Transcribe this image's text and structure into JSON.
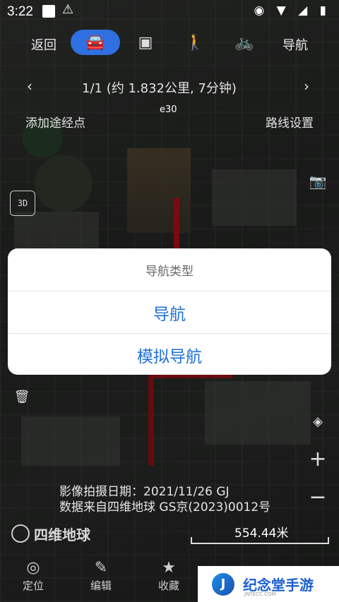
{
  "status_bar": {
    "time": "3:22",
    "warning_icon": "warning-icon",
    "right_icons": "◉ ▼ ◢ ▮"
  },
  "top_nav": {
    "back_label": "返回",
    "modes": [
      "car-icon",
      "bus-icon",
      "walk-icon",
      "bike-icon"
    ],
    "navigate_label": "导航"
  },
  "route": {
    "page": "1/1",
    "summary": "(约 1.832公里, 7分钟)"
  },
  "actions": {
    "add_waypoint": "添加途经点",
    "route_settings": "路线设置"
  },
  "map_labels": {
    "e30": "e30"
  },
  "dialog": {
    "title": "导航类型",
    "options": [
      "导航",
      "模拟导航"
    ]
  },
  "imagery": {
    "capture_date": "影像拍摄日期：2021/11/26 GJ",
    "data_source": "数据来自四维地球 GS京(2023)0012号"
  },
  "brand": "四维地球",
  "scale": "554.44米",
  "bottom_tabs": [
    "定位",
    "编辑",
    "收藏"
  ],
  "watermark": {
    "text": "纪念堂手游",
    "sub": "JNTECC.COM"
  },
  "colors": {
    "accent": "#2f6fe0",
    "dialog_option": "#1e6fd6",
    "route": "#d0141a"
  }
}
